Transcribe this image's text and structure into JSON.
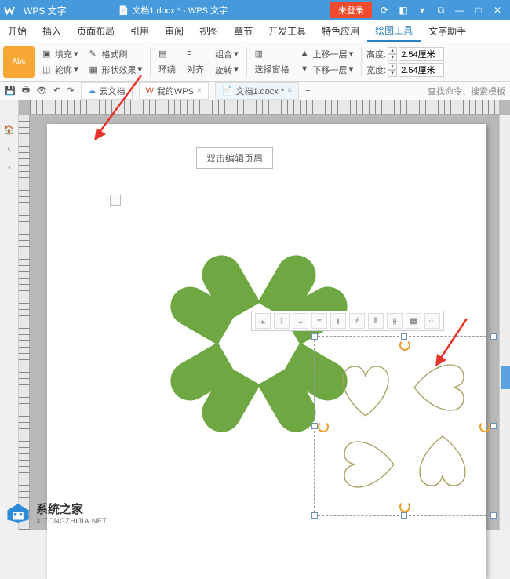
{
  "titlebar": {
    "app_name": "WPS 文字",
    "doc_title": "文档1.docx * - WPS 文字",
    "login_label": "未登录"
  },
  "menu": {
    "tabs": [
      "开始",
      "插入",
      "页面布局",
      "引用",
      "审阅",
      "视图",
      "章节",
      "开发工具",
      "特色应用",
      "绘图工具",
      "文字助手"
    ],
    "active_index": 9
  },
  "ribbon": {
    "shape_sample": "Abc",
    "fill": "填充",
    "format_brush": "格式刷",
    "outline": "轮廓",
    "shape_effects": "形状效果",
    "wrap": "环绕",
    "align": "对齐",
    "group": "组合",
    "rotate": "旋转",
    "select_pane": "选择窗格",
    "move_up": "上移一层",
    "move_down": "下移一层",
    "height_label": "高度:",
    "width_label": "宽度:",
    "height_value": "2.54厘米",
    "width_value": "2.54厘米"
  },
  "qat": {
    "cloud_doc": "云文档",
    "my_wps": "我的WPS",
    "doc_tab": "文档1.docx *",
    "search_placeholder": "查找命令、搜索模板"
  },
  "page": {
    "header_hint": "双击编辑页眉"
  },
  "watermark": {
    "name": "系统之家",
    "url": "XITONGZHIJIA.NET"
  }
}
